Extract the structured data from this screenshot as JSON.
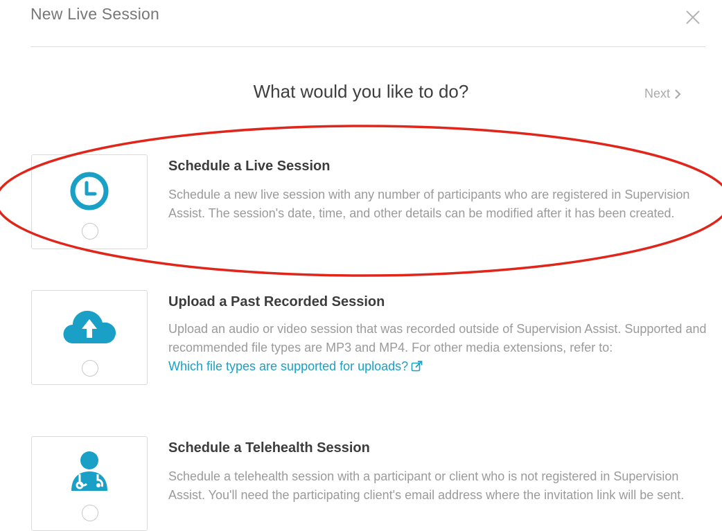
{
  "dialog": {
    "title": "New Live Session",
    "question": "What would you like to do?",
    "next_label": "Next"
  },
  "options": [
    {
      "title": "Schedule a Live Session",
      "description": "Schedule a new live session with any number of participants who are registered in Supervision Assist. The session's date, time, and other details can be modified after it has been created.",
      "icon": "clock-icon"
    },
    {
      "title": "Upload a Past Recorded Session",
      "description": "Upload an audio or video session that was recorded outside of Supervision Assist. Supported and recommended file types are MP3 and MP4. For other media extensions, refer to:",
      "link": "Which file types are supported for uploads?",
      "icon": "cloud-upload-icon"
    },
    {
      "title": "Schedule a Telehealth Session",
      "description": "Schedule a telehealth session with a participant or client who is not registered in Supervision Assist. You'll need the participating client's email address where the invitation link will be sent.",
      "icon": "doctor-icon"
    }
  ],
  "colors": {
    "accent": "#1aa0c6",
    "highlight": "#e0251b",
    "border": "#dadada"
  }
}
